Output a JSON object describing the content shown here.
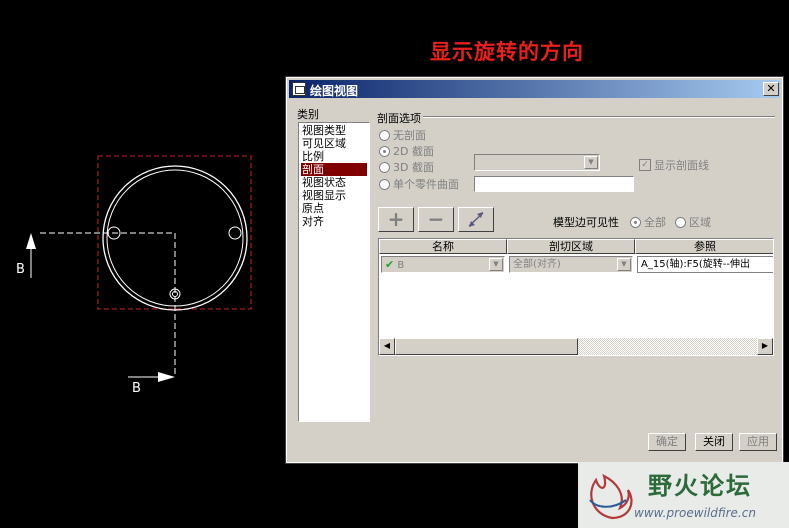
{
  "annotation": "显示旋转的方向",
  "cad": {
    "label_left": "B",
    "label_bottom": "B"
  },
  "dialog": {
    "title": "绘图视图",
    "close_glyph": "✕",
    "category_label": "类别",
    "categories": [
      "视图类型",
      "可见区域",
      "比例",
      "剖面",
      "视图状态",
      "视图显示",
      "原点",
      "对齐"
    ],
    "selected_category": "剖面",
    "group_title": "剖面选项",
    "options": {
      "none": "无剖面",
      "two_d": "2D 截面",
      "three_d": "3D 截面",
      "surface": "单个零件曲面"
    },
    "section_combo_value": "",
    "show_hatch_label": "显示剖面线",
    "tool_buttons": {
      "add": "+",
      "remove": "−"
    },
    "edge_visibility_label": "模型边可见性",
    "visibility_all": "全部",
    "visibility_area": "区域",
    "table": {
      "columns": [
        "名称",
        "剖切区域",
        "参照"
      ],
      "row": {
        "name": "B",
        "region": "全部(对齐)",
        "reference": "A_15(轴):F5(旋转--伸出"
      }
    },
    "buttons": {
      "ok": "确定",
      "close": "关闭",
      "apply": "应用"
    }
  },
  "watermark": {
    "name": "野火论坛",
    "url": "www.proewildfire.cn"
  }
}
